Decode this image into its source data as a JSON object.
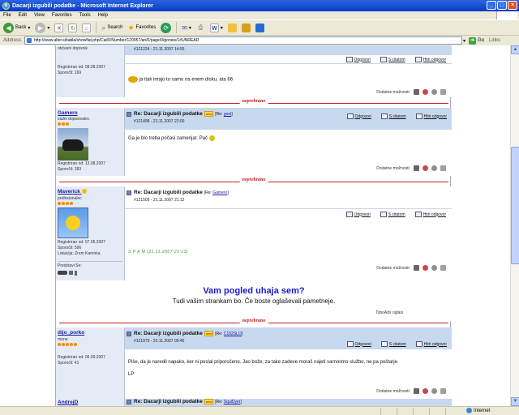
{
  "window": {
    "title": "Dacarji izgubili podatke - Microsoft Internet Explorer"
  },
  "menu": [
    "File",
    "Edit",
    "View",
    "Favorites",
    "Tools",
    "Help"
  ],
  "toolbar": {
    "back": "Back",
    "search": "Search",
    "favorites": "Favorites"
  },
  "address": {
    "label": "Address",
    "url": "http://www.alter.si/tabla/showflat.php/Cat/0/Number/120957/an/0/page/0/gonew/1#UNREAD",
    "go": "Go",
    "links": "Links"
  },
  "status": {
    "zone": "Internet"
  },
  "actions": {
    "odgovori": "Odgovori",
    "citatom": "S citatom",
    "hitri": "Hitri odgovor",
    "dodatne": "Dodatne možnosti:"
  },
  "divider_label": "neprebrano",
  "post0": {
    "rank": "občasni dopisnik",
    "meta": "#121224 - 21.11.2007 14:55",
    "registered": "Registriran od: 08.08.2007",
    "posts": "Sporočil: 169",
    "text": "ja itak imajo to samo na enem disku, ata 66"
  },
  "post1": {
    "username": "Gamero",
    "rank": "stalni dopisovalec",
    "title": "Re: Dacarji izgubili podatke",
    "ref_prefix": "[Re:",
    "ref": "gost",
    "ref_suffix": "]",
    "meta": "#121498 - 21.11.2007 22:00",
    "registered": "Registriran od: 13.08.2007",
    "posts": "Sporočil: 283",
    "text": "Ga je blo treba počasi zamenjat. Pač"
  },
  "post2": {
    "username": "Maverick",
    "rank": "profesionalec",
    "title": "Re: Dacarji izgubili podatke",
    "ref_prefix": "[Re:",
    "ref": "Gamero",
    "ref_suffix": "]",
    "meta": "#121509 - 21.11.2007 21:12",
    "registered": "Registriran od: 07.05.2007",
    "posts": "Sporočil: 596",
    "location": "Lokacija: Zrem Kamnka",
    "predstavi": "Predstavi Se:",
    "text": "S P A M (21.11.2007 21:13)"
  },
  "ad": {
    "headline": "Vam pogled uhaja sem?",
    "subline": "Tudi vašim strankam bo. Če boste oglaševali pametneje.",
    "tag": "ToboAds oglasi"
  },
  "post3": {
    "username": "dijo_porko",
    "rank": "mone",
    "title": "Re: Dacarji izgubili podatke",
    "ref_prefix": "[Re:",
    "ref": "C152SLO",
    "ref_suffix": "]",
    "meta": "#121979 - 22.11.2007 09:45",
    "registered": "Registriran od: 06.09.2007",
    "posts": "Sporočil: 41",
    "text": "Piše, da je naredil napako, ker ni poslal priporočeno. Jao bože, za take zadeve moraš najeti varnostno službo, ne pa poštarje.",
    "sign": "LP"
  },
  "post4": {
    "username": "AndrejD",
    "title": "Re: Dacarji izgubili podatke",
    "ref_prefix": "[Re:",
    "ref": "SquiDyer",
    "ref_suffix": "]"
  },
  "colors": {
    "divider": "#c02020",
    "header_bg": "#c8d8ee",
    "left_bg": "#e4ebf6",
    "ad_headline": "#1a1ad0"
  }
}
